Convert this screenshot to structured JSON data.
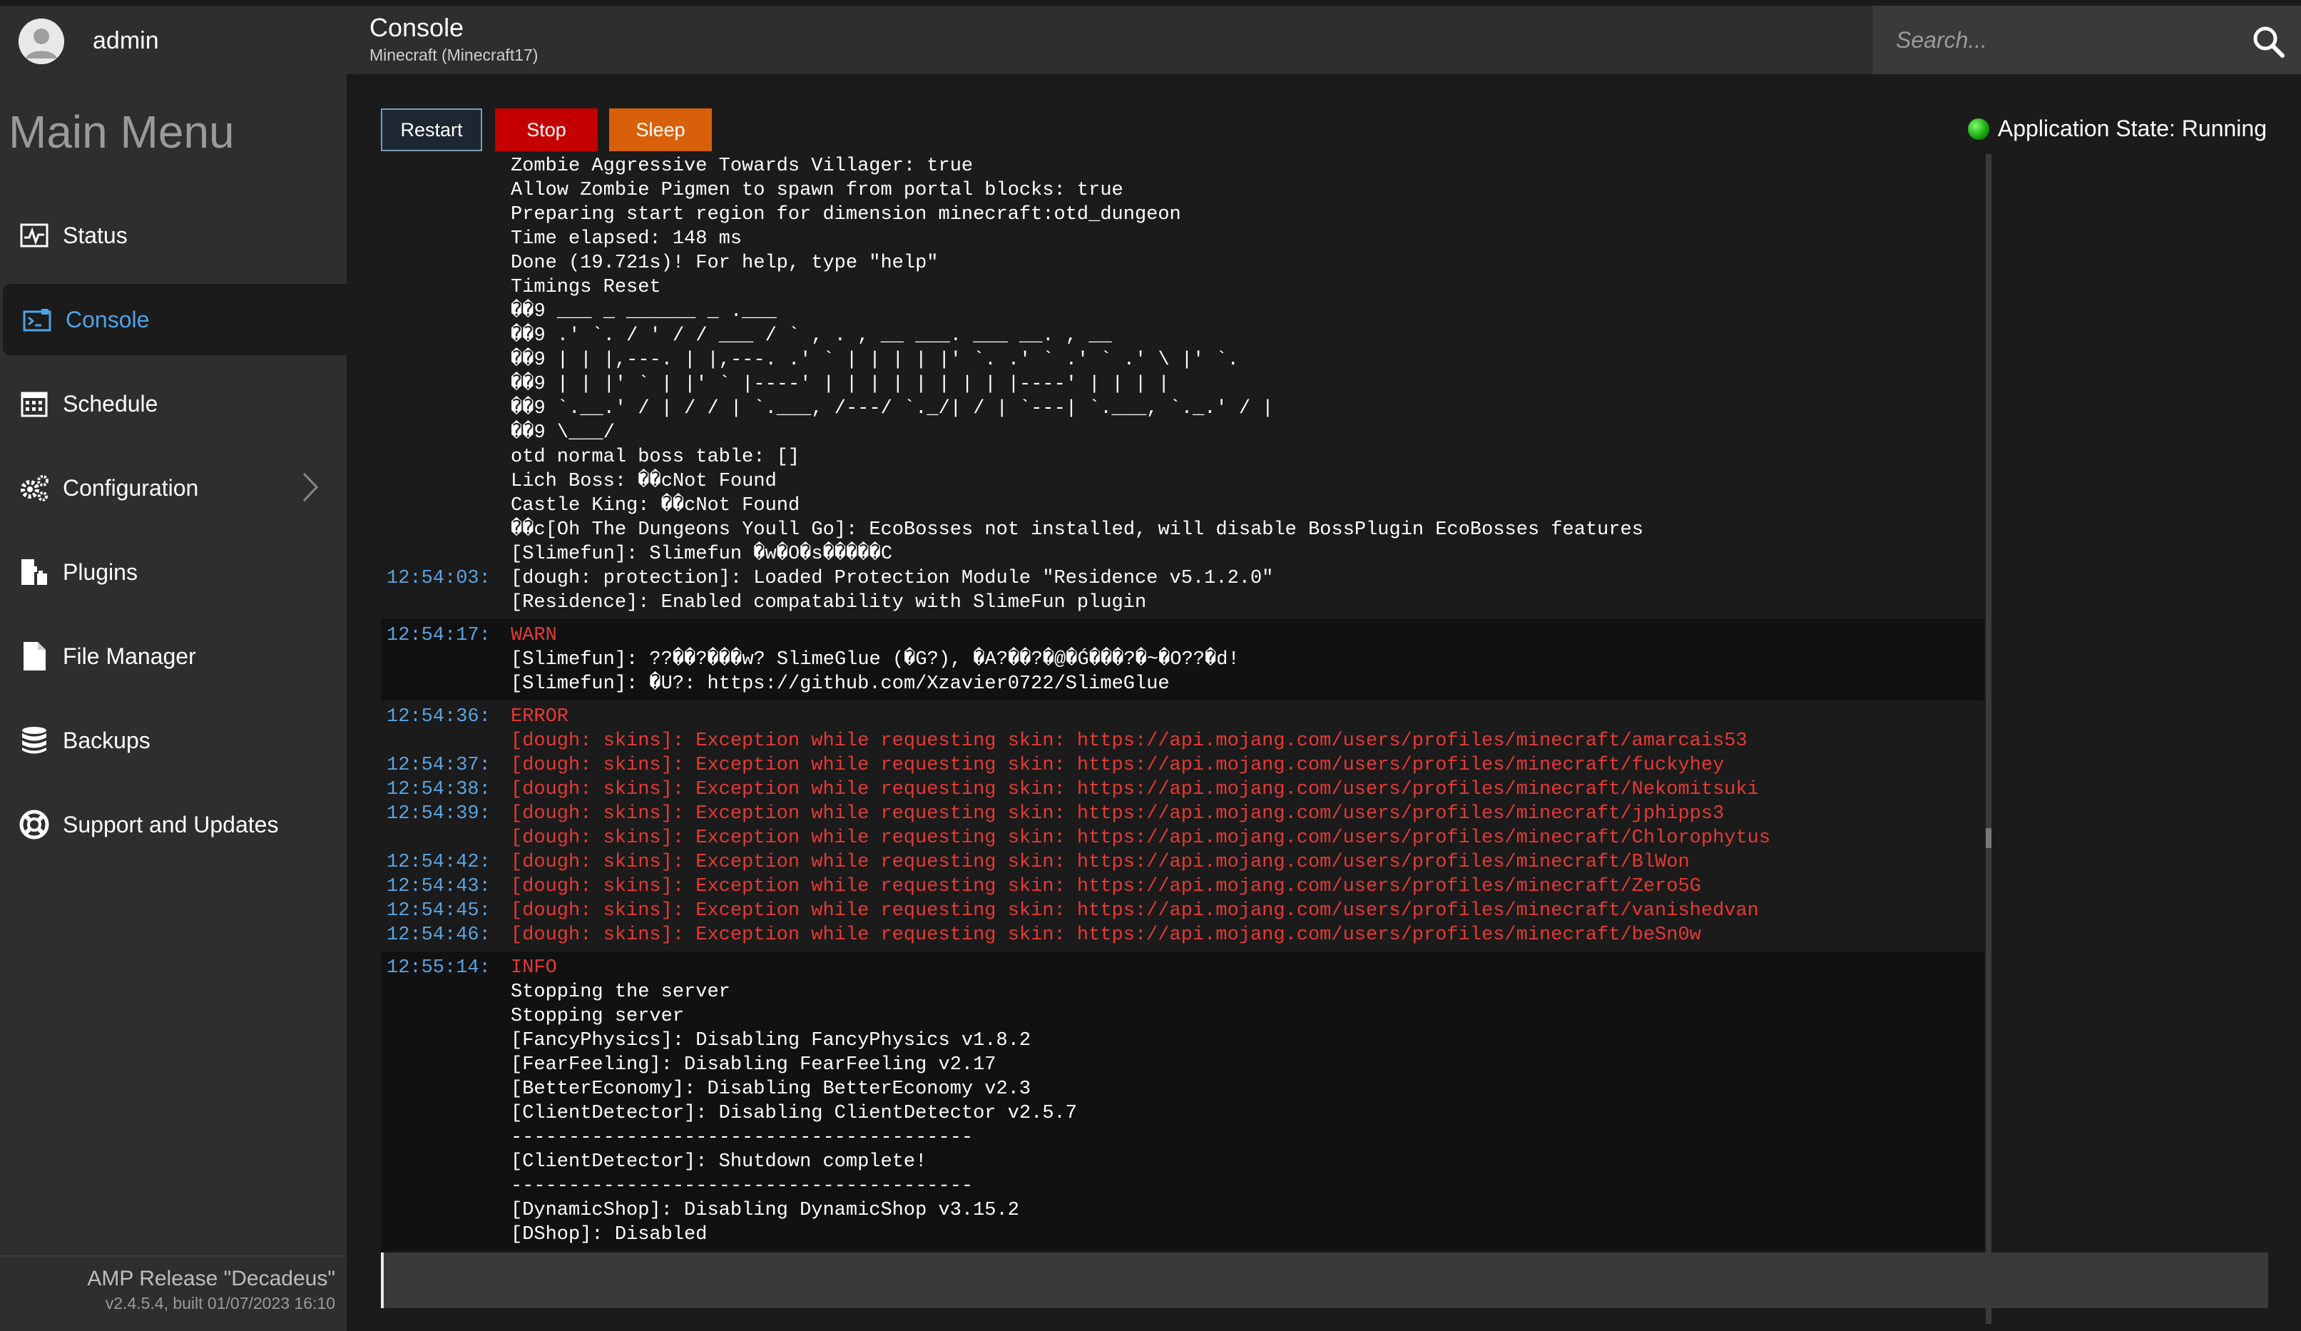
{
  "user": {
    "name": "admin"
  },
  "sidebar": {
    "title": "Main Menu",
    "items": [
      {
        "label": "Status",
        "icon": "status-chart-icon"
      },
      {
        "label": "Console",
        "icon": "console-icon",
        "active": true
      },
      {
        "label": "Schedule",
        "icon": "calendar-icon"
      },
      {
        "label": "Configuration",
        "icon": "gears-icon",
        "has_submenu": true
      },
      {
        "label": "Plugins",
        "icon": "plugins-icon"
      },
      {
        "label": "File Manager",
        "icon": "file-icon"
      },
      {
        "label": "Backups",
        "icon": "database-icon"
      },
      {
        "label": "Support and Updates",
        "icon": "lifebuoy-icon"
      }
    ],
    "footer": {
      "release": "AMP Release \"Decadeus\"",
      "build": "v2.4.5.4, built 01/07/2023 16:10"
    }
  },
  "header": {
    "title": "Console",
    "subtitle": "Minecraft (Minecraft17)",
    "search_placeholder": "Search..."
  },
  "toolbar": {
    "restart_label": "Restart",
    "stop_label": "Stop",
    "sleep_label": "Sleep",
    "app_state": "Application State: Running"
  },
  "colors": {
    "accent": "#4da3e6",
    "stop": "#c40000",
    "sleep": "#d9600a",
    "error": "#e53935",
    "running": "#12a10a"
  },
  "console": {
    "groups": [
      {
        "lines": [
          {
            "time": "",
            "text": "Zombie Aggressive Towards Villager: true"
          },
          {
            "time": "",
            "text": "Allow Zombie Pigmen to spawn from portal blocks: true"
          },
          {
            "time": "",
            "text": "Preparing start region for dimension minecraft:otd_dungeon"
          },
          {
            "time": "",
            "text": "Time elapsed: 148 ms"
          },
          {
            "time": "",
            "text": "Done (19.721s)! For help, type \"help\""
          },
          {
            "time": "",
            "text": "Timings Reset"
          },
          {
            "time": "",
            "text": "��9 ___ _ ______ _ .___"
          },
          {
            "time": "",
            "text": "��9 .' `. / ' / / ___ / ` , . , __ ___. ___ __. , __"
          },
          {
            "time": "",
            "text": "��9 | | |,---. | |,---. .' ` | | | | |' `. .' ` .' ` .' \\ |' `."
          },
          {
            "time": "",
            "text": "��9 | | |' ` | |' ` |----' | | | | | | | | |----' | | | |"
          },
          {
            "time": "",
            "text": "��9 `.__.' / | / / | `.___, /---/ `._/| / | `---| `.___, `._.' / |"
          },
          {
            "time": "",
            "text": "��9 \\___/"
          },
          {
            "time": "",
            "text": "otd normal boss table: []"
          },
          {
            "time": "",
            "text": "Lich Boss: ��cNot Found"
          },
          {
            "time": "",
            "text": "Castle King: ��cNot Found"
          },
          {
            "time": "",
            "text": "��c[Oh The Dungeons Youll Go]: EcoBosses not installed, will disable BossPlugin EcoBosses features"
          },
          {
            "time": "",
            "text": "[Slimefun]: Slimefun �w�O�s�����C"
          },
          {
            "time": "12:54:03:",
            "text": "[dough: protection]: Loaded Protection Module \"Residence v5.1.2.0\""
          },
          {
            "time": "",
            "text": "[Residence]: Enabled compatability with SlimeFun plugin"
          }
        ]
      },
      {
        "alt": true,
        "lines": [
          {
            "time": "12:54:17:",
            "text": "WARN",
            "level": "warn"
          },
          {
            "time": "",
            "text": "[Slimefun]: ??��?���w? SlimeGlue (�G?), �A?��?�@�Ǵ���?�~�O??�d!"
          },
          {
            "time": "",
            "text": "[Slimefun]: �U?: https://github.com/Xzavier0722/SlimeGlue"
          }
        ]
      },
      {
        "lines": [
          {
            "time": "12:54:36:",
            "text": "ERROR",
            "level": "error"
          },
          {
            "time": "",
            "text": "[dough: skins]: Exception while requesting skin: https://api.mojang.com/users/profiles/minecraft/amarcais53",
            "err": true
          },
          {
            "time": "12:54:37:",
            "text": "[dough: skins]: Exception while requesting skin: https://api.mojang.com/users/profiles/minecraft/fuckyhey",
            "err": true
          },
          {
            "time": "12:54:38:",
            "text": "[dough: skins]: Exception while requesting skin: https://api.mojang.com/users/profiles/minecraft/Nekomitsuki",
            "err": true
          },
          {
            "time": "12:54:39:",
            "text": "[dough: skins]: Exception while requesting skin: https://api.mojang.com/users/profiles/minecraft/jphipps3",
            "err": true
          },
          {
            "time": "",
            "text": "[dough: skins]: Exception while requesting skin: https://api.mojang.com/users/profiles/minecraft/Chlorophytus",
            "err": true
          },
          {
            "time": "12:54:42:",
            "text": "[dough: skins]: Exception while requesting skin: https://api.mojang.com/users/profiles/minecraft/BlWon",
            "err": true
          },
          {
            "time": "12:54:43:",
            "text": "[dough: skins]: Exception while requesting skin: https://api.mojang.com/users/profiles/minecraft/Zero5G",
            "err": true
          },
          {
            "time": "12:54:45:",
            "text": "[dough: skins]: Exception while requesting skin: https://api.mojang.com/users/profiles/minecraft/vanishedvan",
            "err": true
          },
          {
            "time": "12:54:46:",
            "text": "[dough: skins]: Exception while requesting skin: https://api.mojang.com/users/profiles/minecraft/beSn0w",
            "err": true
          }
        ]
      },
      {
        "alt": true,
        "lines": [
          {
            "time": "12:55:14:",
            "text": "INFO",
            "level": "info"
          },
          {
            "time": "",
            "text": "Stopping the server"
          },
          {
            "time": "",
            "text": "Stopping server"
          },
          {
            "time": "",
            "text": "[FancyPhysics]: Disabling FancyPhysics v1.8.2"
          },
          {
            "time": "",
            "text": "[FearFeeling]: Disabling FearFeeling v2.17"
          },
          {
            "time": "",
            "text": "[BetterEconomy]: Disabling BetterEconomy v2.3"
          },
          {
            "time": "",
            "text": "[ClientDetector]: Disabling ClientDetector v2.5.7"
          },
          {
            "time": "",
            "text": "----------------------------------------"
          },
          {
            "time": "",
            "text": "[ClientDetector]: Shutdown complete!"
          },
          {
            "time": "",
            "text": "----------------------------------------"
          },
          {
            "time": "",
            "text": "[DynamicShop]: Disabling DynamicShop v3.15.2"
          },
          {
            "time": "",
            "text": "[DShop]: Disabled"
          }
        ]
      }
    ]
  }
}
